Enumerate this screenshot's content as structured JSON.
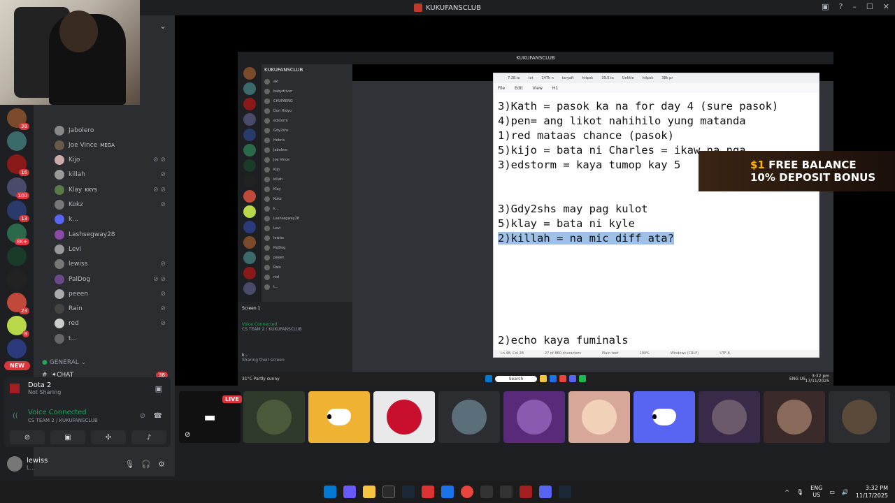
{
  "window": {
    "title": "KUKUFANSCLUB"
  },
  "members": [
    {
      "name": "Jabolero",
      "tag": "",
      "icons": ""
    },
    {
      "name": "Joe Vince",
      "tag": "MEGA",
      "icons": ""
    },
    {
      "name": "Kijo",
      "tag": "",
      "icons": "⊘ ⊘"
    },
    {
      "name": "killah",
      "tag": "",
      "icons": "⊘"
    },
    {
      "name": "Klay",
      "tag": "KKYS",
      "icons": "⊘ ⊘"
    },
    {
      "name": "Kokz",
      "tag": "",
      "icons": "⊘"
    },
    {
      "name": "k...",
      "tag": "",
      "icons": ""
    },
    {
      "name": "Lashsegway28",
      "tag": "",
      "icons": ""
    },
    {
      "name": "Levi",
      "tag": "",
      "icons": ""
    },
    {
      "name": "lewiss",
      "tag": "",
      "icons": "⊘"
    },
    {
      "name": "PalDog",
      "tag": "",
      "icons": "⊘ ⊘"
    },
    {
      "name": "peeen",
      "tag": "",
      "icons": "⊘"
    },
    {
      "name": "Rain",
      "tag": "",
      "icons": "⊘"
    },
    {
      "name": "red",
      "tag": "",
      "icons": "⊘"
    },
    {
      "name": "t...",
      "tag": "",
      "icons": ""
    }
  ],
  "server_badges": [
    "38",
    "",
    "16",
    "100",
    "13",
    "8K+",
    "",
    "",
    "23",
    "8",
    ""
  ],
  "channels": {
    "general_label": "GENERAL",
    "chat_label": "✦CHAT",
    "chat_count": "38"
  },
  "new_label": "NEW",
  "activity": {
    "title": "Dota 2",
    "subtitle": "Not Sharing"
  },
  "voice": {
    "status": "Voice Connected",
    "channel": "CS TEAM 2 / KUKUFANSCLUB"
  },
  "user": {
    "name": "lewiss",
    "sub": "L..."
  },
  "stream": {
    "inner_title": "KUKUFANSCLUB",
    "inner_server_name": "KUKUFANSCLUB",
    "inner_members": [
      "aki",
      "babydriver",
      "CHUPAENG",
      "Don Hidyo",
      "edstorm",
      "Gdy2shs",
      "Hobris",
      "Jabolero",
      "Joe Vince",
      "Kijo",
      "killah",
      "Klay",
      "Kokz",
      "k...",
      "Lashsegway28",
      "Levi",
      "lewiss",
      "PalDog",
      "peeen",
      "Rain",
      "red",
      "t..."
    ],
    "inner_voice": {
      "screen": "Screen 1",
      "status": "Voice Connected",
      "channel": "CS TEAM 2 / KUKUFANSCLUB",
      "user": "k...",
      "user_sub": "Sharing their screen"
    },
    "notepad": {
      "tabs": [
        "7.38.tx",
        "txt",
        "147k n",
        "taryaft",
        "httpsk",
        "39.5.tx",
        "Untitle",
        "httpsk",
        "38k pr"
      ],
      "menu": [
        "File",
        "Edit",
        "View",
        "H1"
      ],
      "lines": [
        "3)Kath = pasok ka na for day 4 (sure pasok)",
        "4)pen= ang likot nahihilo yung matanda",
        "1)red mataas chance (pasok)",
        "5)kijo = bata ni Charles = ikaw na nga",
        "3)edstorm = kaya tumop kay 5",
        "",
        "3)Gdy2shs may pag kulot",
        "5)klay = bata ni kyle",
        "2)killah = na mic diff ata?",
        "2)echo kaya fuminals"
      ],
      "status": [
        "Ln 48, Col 28",
        "27 of 860 characters",
        "Plain text",
        "100%",
        "Windows (CRLF)",
        "UTF-8"
      ]
    },
    "ad": {
      "line1_amount": "$1",
      "line1_rest": "FREE BALANCE",
      "line2": "10% DEPOSIT BONUS"
    },
    "inner_taskbar": {
      "weather": "31°C",
      "weather_sub": "Partly sunny",
      "search": "Search",
      "time": "3:32 pm",
      "date": "17/11/2025",
      "lang": "ENG US"
    }
  },
  "tiles_live_label": "LIVE",
  "taskbar": {
    "lang_top": "ENG",
    "lang_bottom": "US",
    "time": "3:32 PM",
    "date": "11/17/2025"
  },
  "colors": {
    "accent": "#5865f2",
    "green": "#23a55a",
    "red": "#da373c"
  }
}
